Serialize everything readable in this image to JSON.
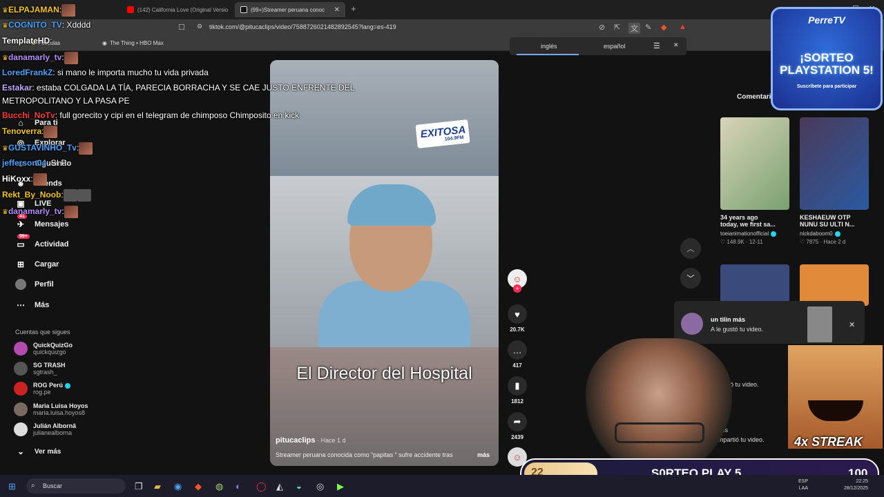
{
  "browser": {
    "tabs": [
      {
        "label": "(142) California Love (Original Versio",
        "active": false
      },
      {
        "label": "(99+)Streamer peruana conoc",
        "active": true
      }
    ],
    "url": "tiktok.com/@pitucaclips/video/7588726021482892545?lang=es-419",
    "bookmarks": [
      {
        "label": "Películas"
      },
      {
        "label": "The Thing • HBO Max"
      }
    ],
    "translate": {
      "left": "inglés",
      "right": "español"
    }
  },
  "tiktok": {
    "nav": [
      {
        "label": "Para ti"
      },
      {
        "label": "Explorar"
      },
      {
        "label": "Siguiendo"
      },
      {
        "label": "Friends"
      },
      {
        "label": "LIVE"
      },
      {
        "label": "Mensajes",
        "badge": "41"
      },
      {
        "label": "Actividad",
        "badge": "99+"
      },
      {
        "label": "Cargar"
      },
      {
        "label": "Perfil"
      },
      {
        "label": "Más"
      }
    ],
    "following_header": "Cuentas que sigues",
    "following": [
      {
        "name": "QuickQuizGo",
        "handle": "quickquizgo"
      },
      {
        "name": "SG TRASH",
        "handle": "sgtrash_"
      },
      {
        "name": "ROG Perú",
        "handle": "rog.pe"
      },
      {
        "name": "Maria Luisa Hoyos",
        "handle": "maria.luisa.hoyos8"
      },
      {
        "name": "Julián Albornâ",
        "handle": "julianealborna"
      }
    ],
    "see_more": "Ver más",
    "video": {
      "station_logo": "EXITOSA",
      "station_freq": "104.9FM",
      "caption": "El Director del Hospital",
      "author": "pitucaclips",
      "age": " · Hace 1 d",
      "description": "Streamer peruana conocida como “papitas ” sufre accidente tras",
      "more": "más"
    },
    "actions": [
      {
        "icon": "heart-icon",
        "count": "20.7K"
      },
      {
        "icon": "comment-icon",
        "count": "417"
      },
      {
        "icon": "bookmark-icon",
        "count": "1812"
      },
      {
        "icon": "share-icon",
        "count": "2439"
      }
    ],
    "comments_tab": "Comentarios",
    "related": [
      {
        "title": "34 years ago",
        "title2": "today, we first sa...",
        "user": "toeianimationofficial",
        "likes": "♡ 148.9K",
        "date": "12-11"
      },
      {
        "title": "KESHAEUW OTP",
        "title2": "NUNU SU ULTI N...",
        "user": "nickdaboom0",
        "likes": "♡ 7875",
        "date": "Hace 2 d"
      }
    ],
    "notification": {
      "name": "un tilin más",
      "text": "A le gustó tu video."
    },
    "notif_partial": [
      {
        "text": "ro"
      },
      {
        "text": "gustó tu video."
      },
      {
        "text": "uss"
      },
      {
        "text": "mpartió tu video."
      }
    ]
  },
  "chat": [
    {
      "user": "ELPAJAMAN",
      "color": "#f5c518",
      "msg": ":"
    },
    {
      "user": "COGNITO_TV",
      "color": "#4aa3ff",
      "msg": ": Xdddd"
    },
    {
      "user": "TemplateHD",
      "color": "#ffffff",
      "msg": ":"
    },
    {
      "user": "danamarly_tv",
      "color": "#b58cff",
      "msg": ":"
    },
    {
      "user": "LoredFrankZ",
      "color": "#4aa3ff",
      "msg": ": si mano le importa mucho tu vida privada"
    },
    {
      "user": "Estakar",
      "color": "#c2a8ff",
      "msg": ": estaba COLGADA LA TÍA, PARECIA BORRACHA Y SE CAE JUSTO ENFRENTE DEL"
    },
    {
      "user": "",
      "color": "#ffffff",
      "msg": "METROPOLITANO Y LA PASA PE"
    },
    {
      "user": "Bucchi_NoTv",
      "color": "#ff3b3b",
      "msg": ": full gorecito y cipi en el telegram de chimposo Chimposito en kick"
    },
    {
      "user": "Tenoverra",
      "color": "#f5c518",
      "msg": ":"
    },
    {
      "user": "GUSTAVINHO_Tv",
      "color": "#4aa3ff",
      "msg": ":"
    },
    {
      "user": "jefferson04",
      "color": "#4aa3ff",
      "msg": ": SI P"
    },
    {
      "user": "HiKoxx",
      "color": "#ffffff",
      "msg": ":"
    },
    {
      "user": "Rekt_By_Noob",
      "color": "#f5c518",
      "msg": ":"
    },
    {
      "user": "danamarly_tv",
      "color": "#b58cff",
      "msg": ":"
    }
  ],
  "overlay": {
    "promo_brand": "PerreTV",
    "promo_title": "¡SORTEO PLAYSTATION 5!",
    "promo_sub": "Suscríbete para participar",
    "streak": "4x STREAK",
    "sorteo_left": "22",
    "sorteo_label": "S0RTEO PLAY 5",
    "sorteo_right": "100"
  },
  "taskbar": {
    "search_placeholder": "Buscar",
    "lang": "ESP",
    "lang2": "LAA",
    "time": "22:25",
    "date": "28/12/2025"
  }
}
